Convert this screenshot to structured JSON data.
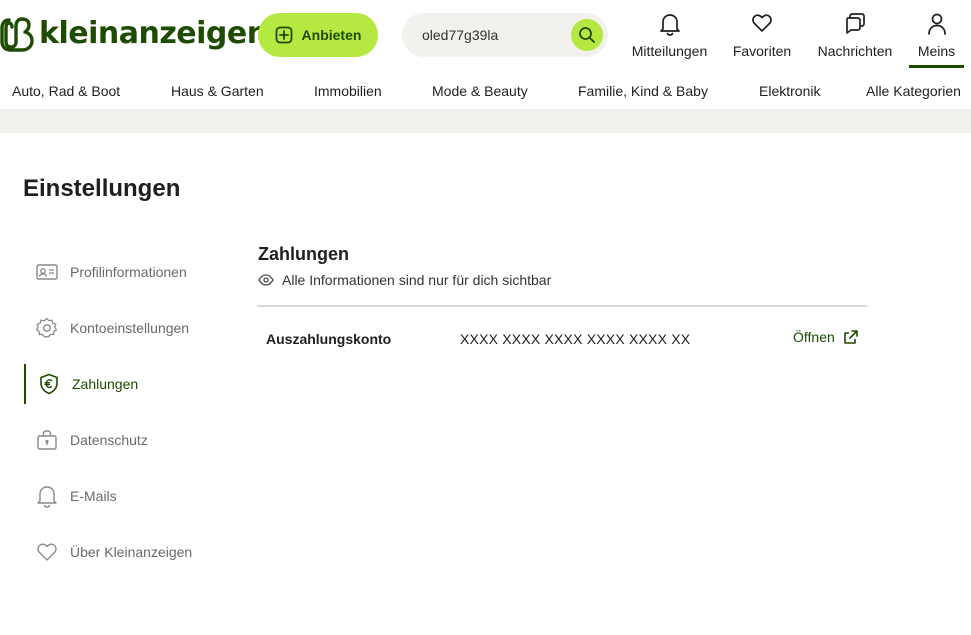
{
  "brand": {
    "logo_text": "kleinanzeigen",
    "accent": "#b5e941",
    "dark_green": "#1d4b00"
  },
  "header": {
    "post_button_label": "Anbieten",
    "search_value": "oled77g39la",
    "nav": [
      {
        "label": "Mitteilungen",
        "icon": "bell-icon"
      },
      {
        "label": "Favoriten",
        "icon": "heart-icon"
      },
      {
        "label": "Nachrichten",
        "icon": "chat-icon"
      },
      {
        "label": "Meins",
        "icon": "user-icon",
        "active": true
      }
    ]
  },
  "categories": [
    "Auto, Rad & Boot",
    "Haus & Garten",
    "Immobilien",
    "Mode & Beauty",
    "Familie, Kind & Baby",
    "Elektronik",
    "Alle Kategorien"
  ],
  "page": {
    "title": "Einstellungen"
  },
  "sidebar": {
    "items": [
      {
        "label": "Profilinformationen",
        "icon": "id-card-icon"
      },
      {
        "label": "Kontoeinstellungen",
        "icon": "gear-icon"
      },
      {
        "label": "Zahlungen",
        "icon": "euro-shield-icon",
        "active": true
      },
      {
        "label": "Datenschutz",
        "icon": "lock-bag-icon"
      },
      {
        "label": "E-Mails",
        "icon": "bell-icon"
      },
      {
        "label": "Über Kleinanzeigen",
        "icon": "heart-icon"
      }
    ]
  },
  "payments": {
    "title": "Zahlungen",
    "visibility_note": "Alle Informationen sind nur für dich sichtbar",
    "account_label": "Auszahlungskonto",
    "account_value": "XXXX XXXX XXXX XXXX XXXX XX",
    "open_label": "Öffnen"
  }
}
